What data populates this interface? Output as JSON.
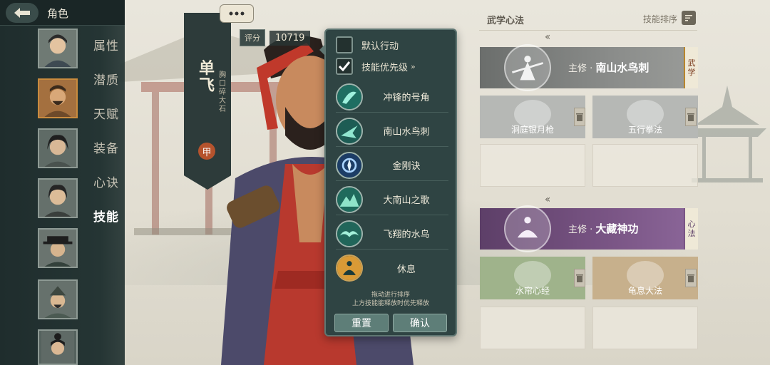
{
  "header": {
    "title": "角色"
  },
  "sidebar": {
    "menu": [
      {
        "label": "属性",
        "active": false
      },
      {
        "label": "潜质",
        "active": false
      },
      {
        "label": "天赋",
        "active": false
      },
      {
        "label": "装备",
        "active": false
      },
      {
        "label": "心诀",
        "active": false
      },
      {
        "label": "技能",
        "active": true
      }
    ],
    "selected_avatar": 1
  },
  "character": {
    "name": "单飞",
    "subtitle": "胸口碎大石",
    "grade": "甲",
    "score_label": "评分",
    "score_value": "10719"
  },
  "popup": {
    "default_action_label": "默认行动",
    "default_action_checked": false,
    "skill_priority_label": "技能优先级",
    "skill_priority_checked": true,
    "skills": [
      {
        "name": "冲锋的号角",
        "icon": "horn-skill-icon"
      },
      {
        "name": "南山水鸟刺",
        "icon": "bird-thrust-skill-icon"
      },
      {
        "name": "金刚诀",
        "icon": "vajra-skill-icon"
      },
      {
        "name": "大南山之歌",
        "icon": "mountain-song-skill-icon"
      },
      {
        "name": "飞翔的水鸟",
        "icon": "flying-bird-skill-icon"
      },
      {
        "name": "休息",
        "icon": "rest-skill-icon"
      }
    ],
    "hint_line1": "拖动进行排序",
    "hint_line2": "上方技能能释放时优先释放",
    "reset_label": "重置",
    "confirm_label": "确认"
  },
  "right_panel": {
    "title": "武学心法",
    "sort_label": "技能排序",
    "martial": {
      "main_prefix": "主修 ·",
      "main_name": "南山水鸟刺",
      "tag": "武学",
      "subs": [
        "洞庭银月枪",
        "五行拳法"
      ]
    },
    "mind": {
      "main_prefix": "主修 ·",
      "main_name": "大藏神功",
      "tag": "心法",
      "subs": [
        "水帘心经",
        "龟息大法"
      ]
    }
  },
  "colors": {
    "sidebar_bg": "#253534",
    "popup_bg": "#2f4443",
    "martial_main": "#8a8c8a",
    "mind_main": "#7a5585",
    "grade_badge": "#b5532d"
  }
}
